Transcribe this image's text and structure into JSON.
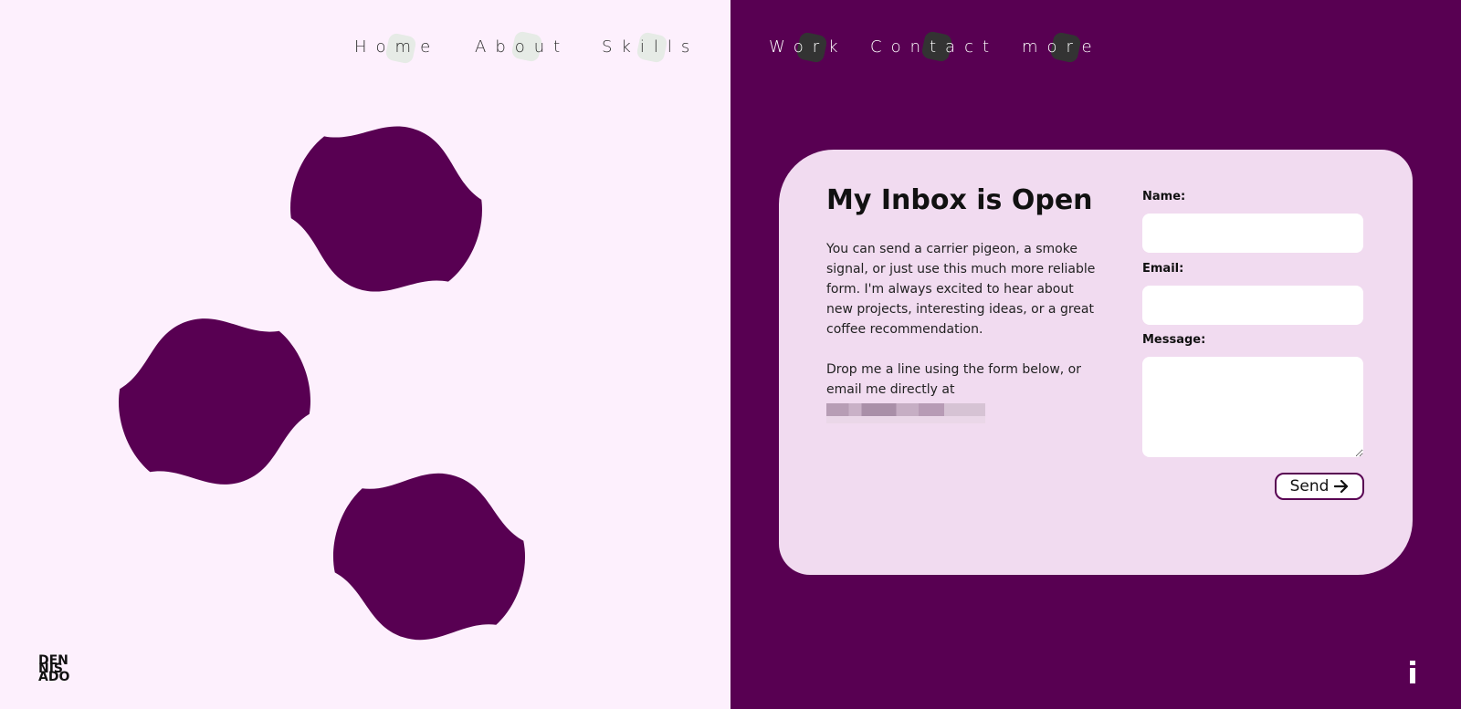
{
  "colors": {
    "left_background": "#fdf0fd",
    "right_background": "#580052",
    "accent": "#580052",
    "card_background": "#f1dbf0",
    "nav_blob_light": "#e6ebe6",
    "nav_blob_dark": "#333333"
  },
  "nav": {
    "items": [
      {
        "label": "Home"
      },
      {
        "label": "About"
      },
      {
        "label": "Skills"
      },
      {
        "label": "Work"
      },
      {
        "label": "Contact"
      },
      {
        "label": "more"
      }
    ]
  },
  "logo": {
    "line1": "DEN",
    "line2": "NIS",
    "line3": "ADO"
  },
  "contact": {
    "title": "My Inbox is Open",
    "paragraph1": "You can send a carrier pigeon, a smoke signal, or just use this much more reliable form. I'm always excited to hear about new projects, interesting ideas, or a great coffee recommendation.",
    "paragraph2": "Drop me a line using the form below, or email me directly at"
  },
  "form": {
    "name_label": "Name:",
    "name_value": "",
    "email_label": "Email:",
    "email_value": "",
    "message_label": "Message:",
    "message_value": "",
    "send_label": "Send",
    "send_icon": "arrow-right-icon"
  },
  "icons": {
    "info": "info-icon"
  }
}
